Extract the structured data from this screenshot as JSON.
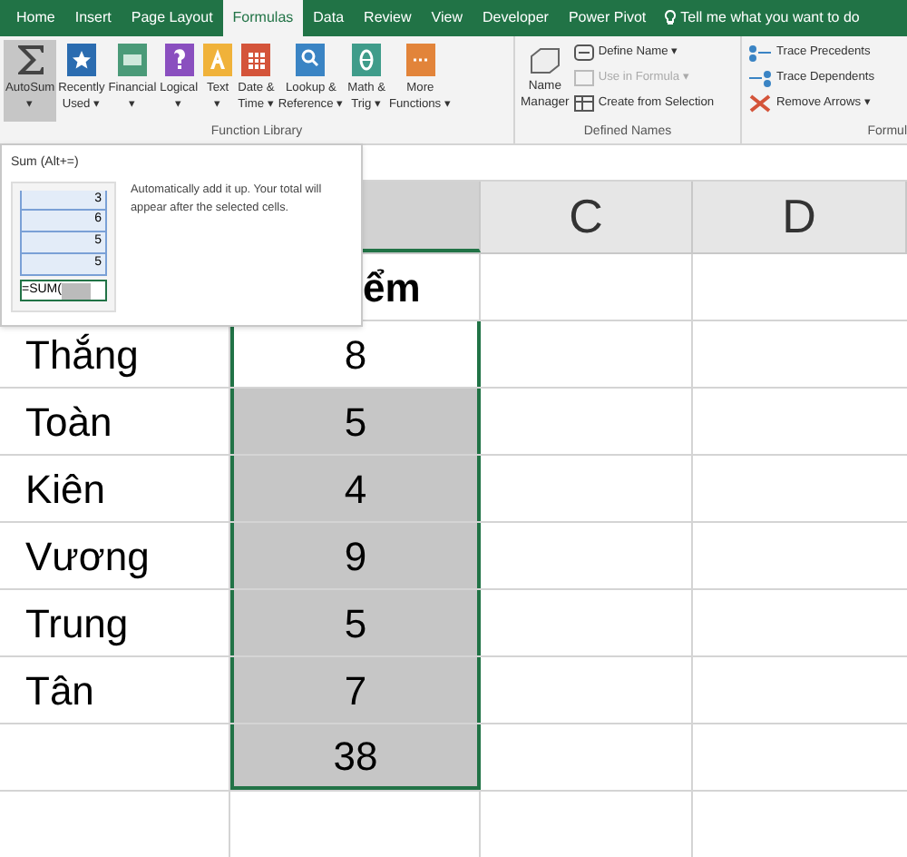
{
  "tabs": [
    {
      "label": "Home",
      "selected": false
    },
    {
      "label": "Insert",
      "selected": false
    },
    {
      "label": "Page Layout",
      "selected": false
    },
    {
      "label": "Formulas",
      "selected": true
    },
    {
      "label": "Data",
      "selected": false
    },
    {
      "label": "Review",
      "selected": false
    },
    {
      "label": "View",
      "selected": false
    },
    {
      "label": "Developer",
      "selected": false
    },
    {
      "label": "Power Pivot",
      "selected": false
    }
  ],
  "tell_me": "Tell me what you want to do",
  "function_library": {
    "label": "Function Library",
    "buttons": [
      {
        "kind": "sum",
        "lines": [
          "AutoSum",
          "▾"
        ],
        "hovered": true
      },
      {
        "kind": "star",
        "lines": [
          "Recently",
          "Used ▾"
        ],
        "hovered": false
      },
      {
        "kind": "money",
        "lines": [
          "Financial",
          "▾"
        ],
        "hovered": false
      },
      {
        "kind": "question",
        "lines": [
          "Logical",
          "▾"
        ],
        "hovered": false
      },
      {
        "kind": "text",
        "lines": [
          "Text",
          "▾"
        ],
        "hovered": false
      },
      {
        "kind": "calendar",
        "lines": [
          "Date &",
          "Time ▾"
        ],
        "hovered": false
      },
      {
        "kind": "lookup",
        "lines": [
          "Lookup &",
          "Reference ▾"
        ],
        "hovered": false
      },
      {
        "kind": "theta",
        "lines": [
          "Math &",
          "Trig ▾"
        ],
        "hovered": false
      },
      {
        "kind": "more",
        "lines": [
          "More",
          "Functions ▾"
        ],
        "hovered": false
      }
    ]
  },
  "defined_names": {
    "label": "Defined Names",
    "manager": [
      "Name",
      "Manager"
    ],
    "items": [
      {
        "label": "Define Name  ▾",
        "disabled": false
      },
      {
        "label": "Use in Formula ▾",
        "disabled": true
      },
      {
        "label": "Create from Selection",
        "disabled": false
      }
    ]
  },
  "formula_auditing": {
    "label": "Formul",
    "items": [
      {
        "label": "Trace Precedents"
      },
      {
        "label": "Trace Dependents"
      },
      {
        "label": "Remove Arrows  ▾"
      }
    ]
  },
  "tooltip": {
    "title": "Sum (Alt+=)",
    "description": "Automatically add it up. Your total will appear after the selected cells.",
    "sample_values": [
      "3",
      "6",
      "5",
      "5"
    ],
    "sample_formula": "=SUM("
  },
  "grid": {
    "columns": [
      {
        "selected": true
      },
      {
        "label": "C",
        "selected": false
      },
      {
        "label": "D",
        "selected": false
      }
    ],
    "rows": [
      {
        "name": "",
        "score": "ểm",
        "header": true,
        "selected": false
      },
      {
        "name": "Thắng",
        "score": "8",
        "header": false,
        "selected": false
      },
      {
        "name": "Toàn",
        "score": "5",
        "header": false,
        "selected": true
      },
      {
        "name": "Kiên",
        "score": "4",
        "header": false,
        "selected": true
      },
      {
        "name": "Vương",
        "score": "9",
        "header": false,
        "selected": true
      },
      {
        "name": "Trung",
        "score": "5",
        "header": false,
        "selected": true
      },
      {
        "name": "Tân",
        "score": "7",
        "header": false,
        "selected": true
      },
      {
        "name": "",
        "score": "38",
        "header": false,
        "selected": true
      }
    ]
  }
}
